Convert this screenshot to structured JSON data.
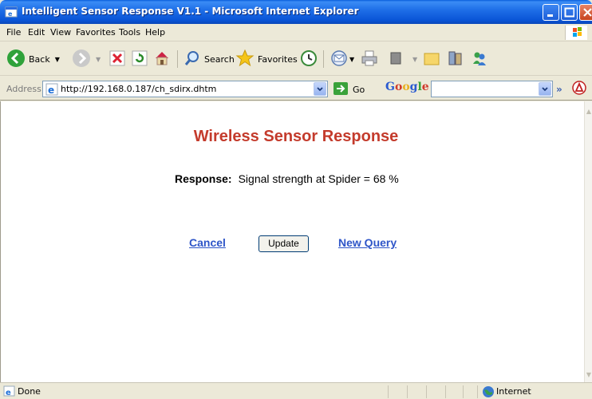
{
  "window": {
    "title": "Intelligent Sensor Response V1.1 - Microsoft Internet Explorer"
  },
  "menu": {
    "items": [
      "File",
      "Edit",
      "View",
      "Favorites",
      "Tools",
      "Help"
    ]
  },
  "toolbar": {
    "back_label": "Back",
    "search_label": "Search",
    "favorites_label": "Favorites"
  },
  "address": {
    "label": "Address",
    "url": "http://192.168.0.187/ch_sdirx.dhtm",
    "go_label": "Go",
    "search_provider": "Google",
    "search_value": ""
  },
  "page": {
    "heading": "Wireless Sensor Response",
    "response_label": "Response:",
    "response_value": "Signal strength at Spider = 68 %",
    "cancel_label": "Cancel",
    "update_label": "Update",
    "new_query_label": "New Query"
  },
  "status": {
    "text": "Done",
    "zone": "Internet"
  },
  "icons": {
    "back": "back-arrow-icon",
    "forward": "forward-arrow-icon",
    "stop": "stop-icon",
    "refresh": "refresh-icon",
    "home": "home-icon",
    "search": "search-icon",
    "favorites": "favorites-star-icon",
    "history": "history-icon",
    "mail": "mail-icon",
    "print": "print-icon",
    "edit": "edit-icon",
    "folder": "folder-icon",
    "research": "research-icon",
    "messenger": "messenger-icon"
  },
  "colors": {
    "heading": "#c43b2c",
    "link": "#2e55c8",
    "titlebar": "#0954d6"
  }
}
